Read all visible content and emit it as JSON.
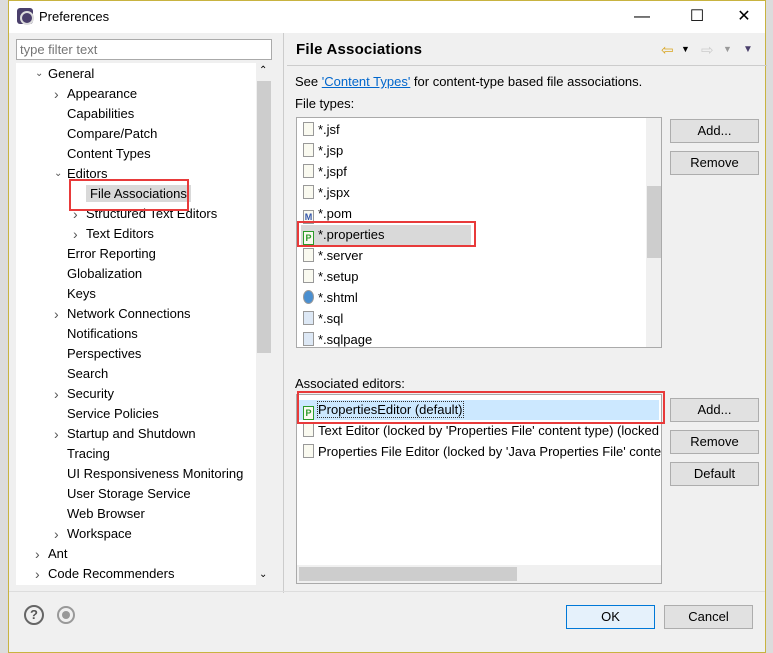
{
  "window": {
    "title": "Preferences",
    "minimize": "—",
    "maximize": "☐",
    "close": "✕"
  },
  "filter": {
    "placeholder": "type filter text"
  },
  "tree": [
    {
      "label": "General",
      "level": 0,
      "chevron": "down"
    },
    {
      "label": "Appearance",
      "level": 1,
      "chevron": "right"
    },
    {
      "label": "Capabilities",
      "level": 1
    },
    {
      "label": "Compare/Patch",
      "level": 1
    },
    {
      "label": "Content Types",
      "level": 1
    },
    {
      "label": "Editors",
      "level": 1,
      "chevron": "down"
    },
    {
      "label": "File Associations",
      "level": 2,
      "selected": true
    },
    {
      "label": "Structured Text Editors",
      "level": 2,
      "chevron": "right"
    },
    {
      "label": "Text Editors",
      "level": 2,
      "chevron": "right"
    },
    {
      "label": "Error Reporting",
      "level": 1
    },
    {
      "label": "Globalization",
      "level": 1
    },
    {
      "label": "Keys",
      "level": 1
    },
    {
      "label": "Network Connections",
      "level": 1,
      "chevron": "right"
    },
    {
      "label": "Notifications",
      "level": 1
    },
    {
      "label": "Perspectives",
      "level": 1
    },
    {
      "label": "Search",
      "level": 1
    },
    {
      "label": "Security",
      "level": 1,
      "chevron": "right"
    },
    {
      "label": "Service Policies",
      "level": 1
    },
    {
      "label": "Startup and Shutdown",
      "level": 1,
      "chevron": "right"
    },
    {
      "label": "Tracing",
      "level": 1
    },
    {
      "label": "UI Responsiveness Monitoring",
      "level": 1
    },
    {
      "label": "User Storage Service",
      "level": 1
    },
    {
      "label": "Web Browser",
      "level": 1
    },
    {
      "label": "Workspace",
      "level": 1,
      "chevron": "right"
    },
    {
      "label": "Ant",
      "level": 0,
      "chevron": "right"
    },
    {
      "label": "Code Recommenders",
      "level": 0,
      "chevron": "right"
    }
  ],
  "page": {
    "title": "File Associations",
    "see_prefix": "See ",
    "see_link": "'Content Types'",
    "see_suffix": " for content-type based file associations.",
    "file_types_label": "File types:",
    "file_types": [
      {
        "name": "*.jsf",
        "icon": "file"
      },
      {
        "name": "*.jsp",
        "icon": "file"
      },
      {
        "name": "*.jspf",
        "icon": "file"
      },
      {
        "name": "*.jspx",
        "icon": "file"
      },
      {
        "name": "*.pom",
        "icon": "maven"
      },
      {
        "name": "*.properties",
        "icon": "properties",
        "selected": true
      },
      {
        "name": "*.server",
        "icon": "file"
      },
      {
        "name": "*.setup",
        "icon": "setup"
      },
      {
        "name": "*.shtml",
        "icon": "globe"
      },
      {
        "name": "*.sql",
        "icon": "sql"
      },
      {
        "name": "*.sqlpage",
        "icon": "sql"
      }
    ],
    "editors_label": "Associated editors:",
    "editors": [
      {
        "name": "PropertiesEditor (default)",
        "icon": "properties",
        "selected": true
      },
      {
        "name": "Text Editor (locked by 'Properties File' content type) (locked",
        "icon": "text"
      },
      {
        "name": "Properties File Editor (locked by 'Java Properties File' conte",
        "icon": "text"
      }
    ],
    "buttons": {
      "add": "Add...",
      "remove": "Remove",
      "add2": "Add...",
      "remove2": "Remove",
      "default": "Default"
    }
  },
  "footer": {
    "ok": "OK",
    "cancel": "Cancel",
    "help": "?"
  },
  "colors": {
    "highlight": "#e83a3a",
    "selection": "#cce8ff",
    "link": "#0066cc"
  }
}
